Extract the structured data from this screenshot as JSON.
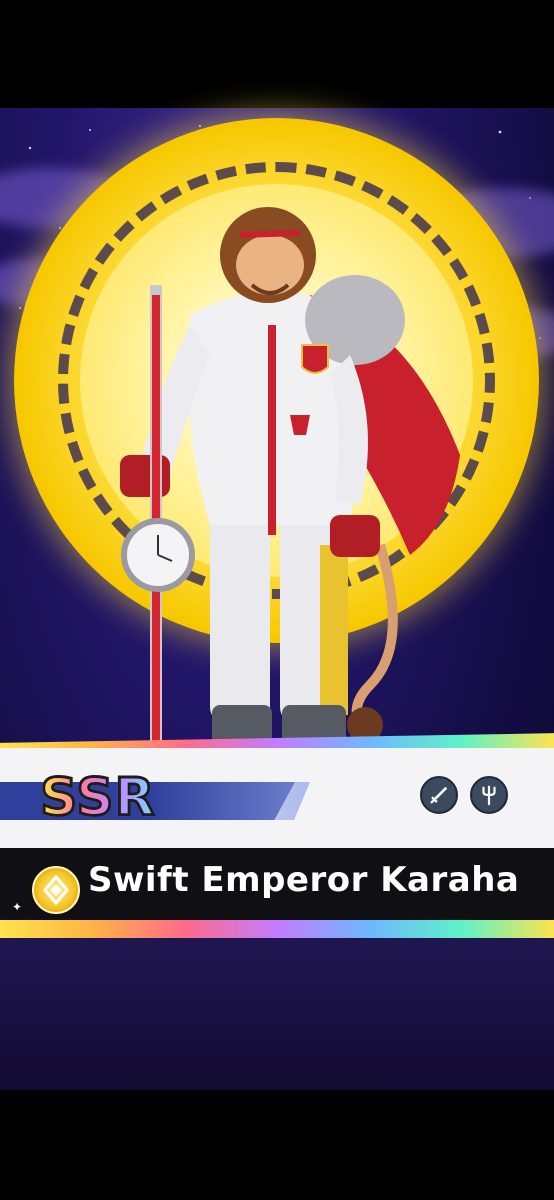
{
  "card": {
    "rarity": "SSR",
    "name": "Swift Emperor Karaha",
    "type_icons": [
      "sword-icon",
      "trident-icon"
    ],
    "attribute_icon": "gold-diamond-attribute-icon"
  },
  "colors": {
    "banner_blue": "#2f3f9c",
    "ring_gold": "#f7c800",
    "sky_purple": "#23166a",
    "name_band": "#101014"
  }
}
